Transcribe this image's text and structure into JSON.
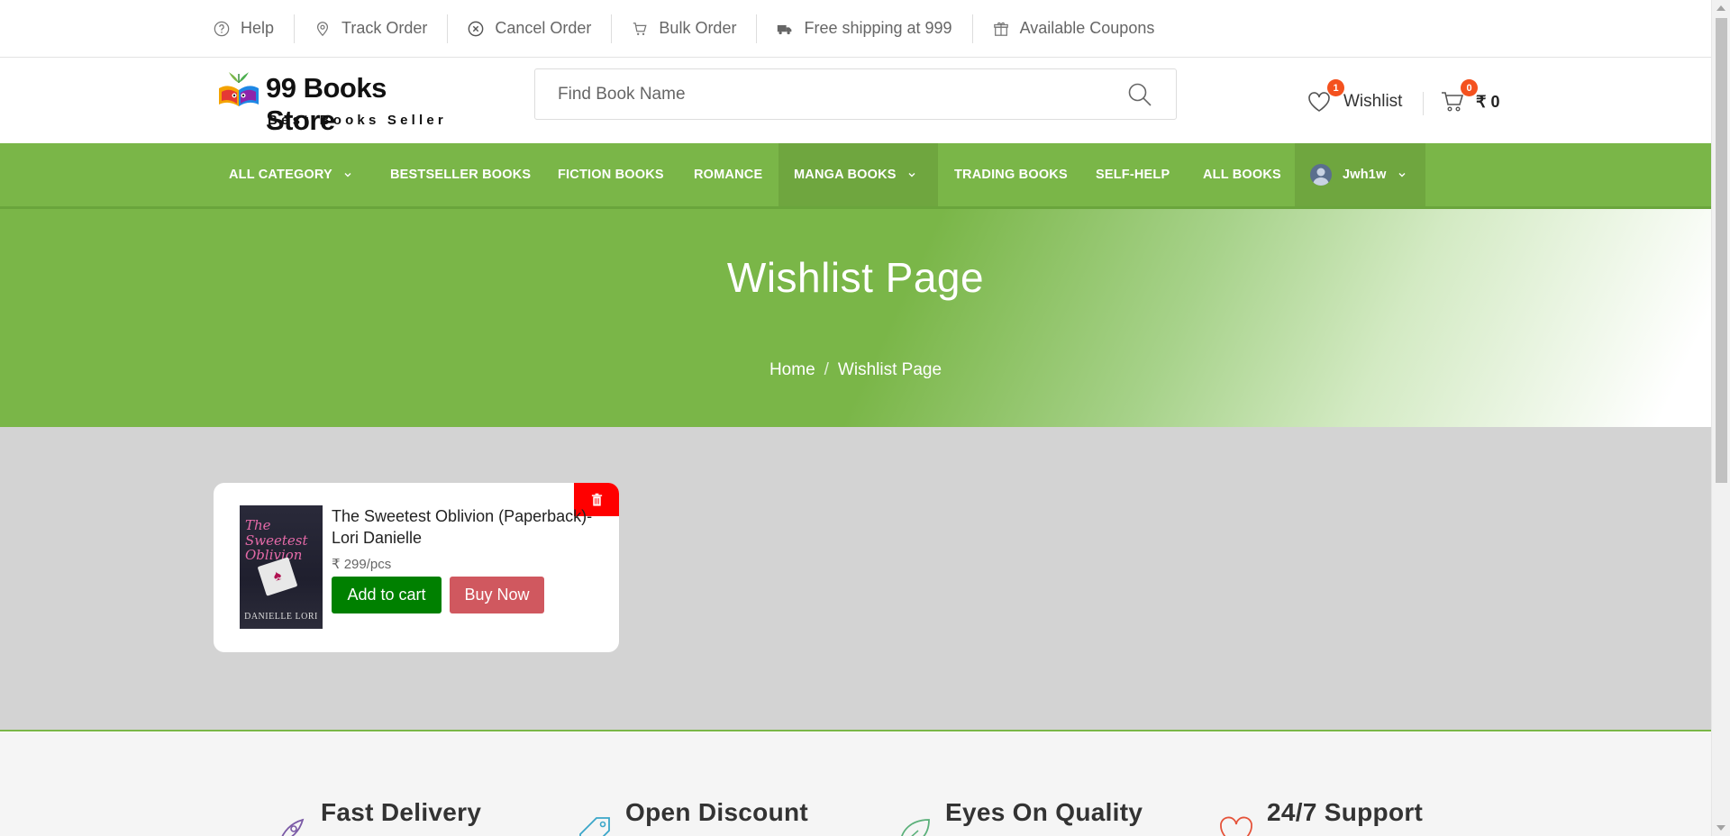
{
  "topbar": {
    "items": [
      {
        "label": "Help",
        "icon": "help-circle-icon"
      },
      {
        "label": "Track Order",
        "icon": "location-pin-icon"
      },
      {
        "label": "Cancel Order",
        "icon": "x-circle-icon"
      },
      {
        "label": "Bulk Order",
        "icon": "cart-icon"
      },
      {
        "label": "Free shipping at 999",
        "icon": "truck-icon"
      },
      {
        "label": "Available Coupons",
        "icon": "gift-icon"
      }
    ]
  },
  "header": {
    "brand": "99 Books Store",
    "tagline": "Best Books Seller",
    "search_placeholder": "Find Book Name",
    "wishlist_label": "Wishlist",
    "wishlist_count": "1",
    "cart_count": "0",
    "cart_total": "₹ 0"
  },
  "nav": {
    "items": [
      {
        "label": "ALL CATEGORY",
        "has_dropdown": true
      },
      {
        "label": "BESTSELLER BOOKS"
      },
      {
        "label": "FICTION BOOKS"
      },
      {
        "label": "ROMANCE"
      },
      {
        "label": "MANGA BOOKS",
        "has_dropdown": true,
        "active": true
      },
      {
        "label": "TRADING BOOKS"
      },
      {
        "label": "SELF-HELP"
      },
      {
        "label": "ALL BOOKS"
      }
    ],
    "user_name": "Jwh1w"
  },
  "hero": {
    "title": "Wishlist Page",
    "breadcrumb": [
      "Home",
      "Wishlist Page"
    ]
  },
  "wishlist": {
    "items": [
      {
        "title": "The Sweetest Oblivion (Paperback)- Lori Danielle",
        "price": "₹ 299/pcs",
        "cover_title": "The Sweetest Oblivion",
        "cover_author": "DANIELLE LORI",
        "add_to_cart_label": "Add to cart",
        "buy_now_label": "Buy Now"
      }
    ]
  },
  "features": [
    {
      "title": "Fast Delivery",
      "icon": "rocket-icon"
    },
    {
      "title": "Open Discount",
      "icon": "tag-icon"
    },
    {
      "title": "Eyes On Quality",
      "icon": "leaf-icon"
    },
    {
      "title": "24/7 Support",
      "icon": "heart-icon"
    }
  ],
  "colors": {
    "primary_green": "#7ab648",
    "add_to_cart": "#008000",
    "buy_now": "#d0585f",
    "delete": "#ff0000",
    "badge": "#f4511e"
  }
}
